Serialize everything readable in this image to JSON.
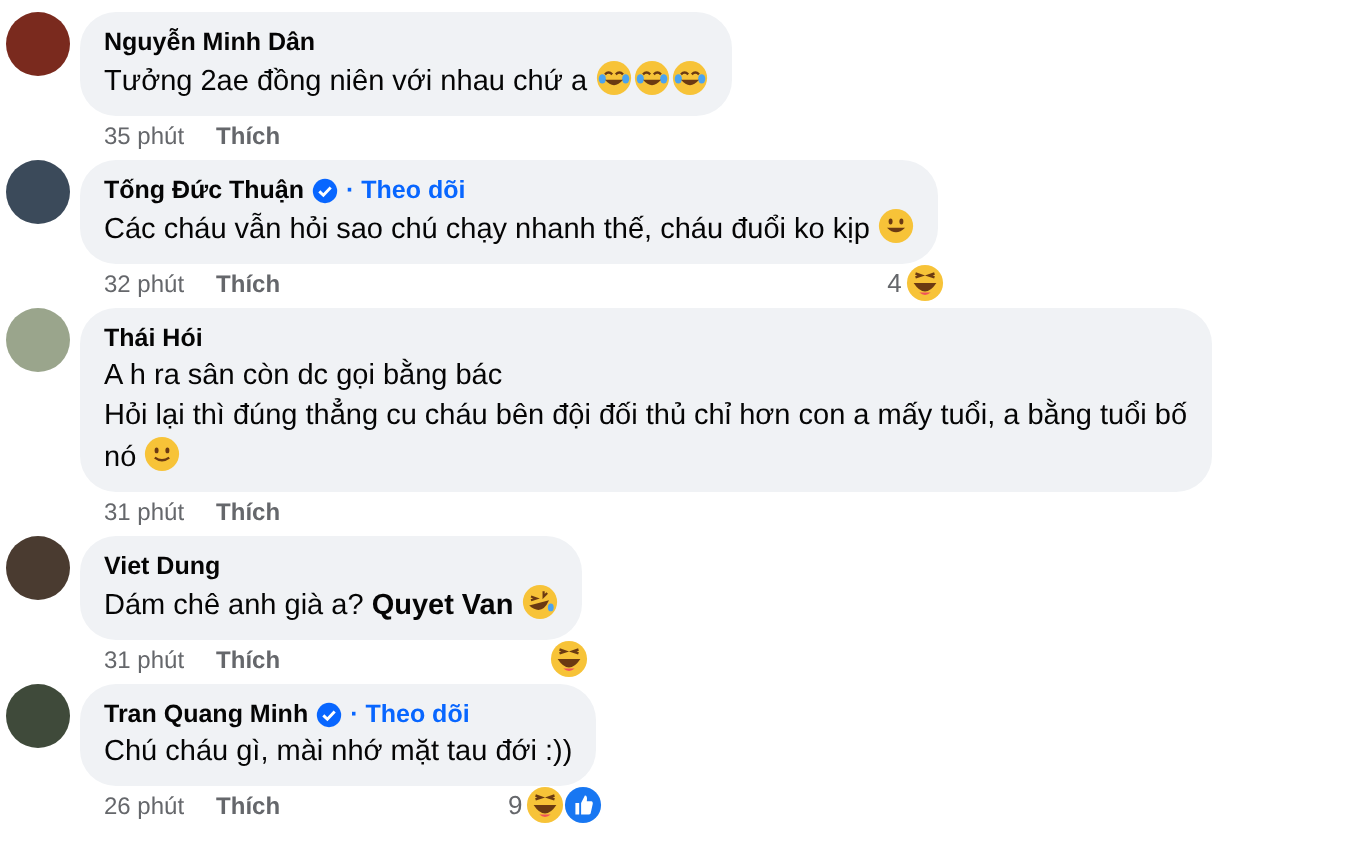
{
  "comments": [
    {
      "name": "Nguyễn Minh Dân",
      "verified": false,
      "paragraphs": [
        "Tưởng 2ae đồng niên với nhau chứ a"
      ],
      "emojis": [
        {
          "kind": "tears-of-joy"
        },
        {
          "kind": "tears-of-joy"
        },
        {
          "kind": "tears-of-joy"
        }
      ],
      "time": "35 phút",
      "like": "Thích"
    },
    {
      "name": "Tống Đức Thuận",
      "verified": true,
      "follow": "· Theo dõi",
      "paragraphs": [
        "Các cháu vẫn hỏi sao chú chạy nhanh thế, cháu đuổi ko kịp"
      ],
      "emojis": [
        {
          "kind": "grin"
        }
      ],
      "time": "32 phút",
      "like": "Thích",
      "reactions": {
        "count": "4",
        "icons": [
          {
            "kind": "haha"
          }
        ]
      }
    },
    {
      "name": "Thái Hói",
      "verified": false,
      "paragraphs": [
        "A h ra sân còn dc gọi bằng bác",
        "Hỏi lại thì đúng thẳng cu cháu bên đội đối thủ chỉ hơn con a mấy tuổi, a bằng tuổi bố",
        "nó"
      ],
      "emojis": [
        {
          "kind": "smile"
        }
      ],
      "time": "31 phút",
      "like": "Thích"
    },
    {
      "name": "Viet Dung",
      "verified": false,
      "paragraphs": [
        "Dám chê anh già a? **Quyet Van**"
      ],
      "emojis": [
        {
          "kind": "rofl"
        }
      ],
      "time": "31 phút",
      "like": "Thích",
      "reactions": {
        "icons": [
          {
            "kind": "haha"
          }
        ]
      }
    },
    {
      "name": "Tran Quang Minh",
      "verified": true,
      "follow": "· Theo dõi",
      "paragraphs": [
        "Chú cháu gì, mài nhớ mặt tau đới :))"
      ],
      "time": "26 phút",
      "like": "Thích",
      "reactions": {
        "count": "9",
        "icons": [
          {
            "kind": "haha"
          },
          {
            "kind": "like"
          }
        ]
      }
    }
  ]
}
